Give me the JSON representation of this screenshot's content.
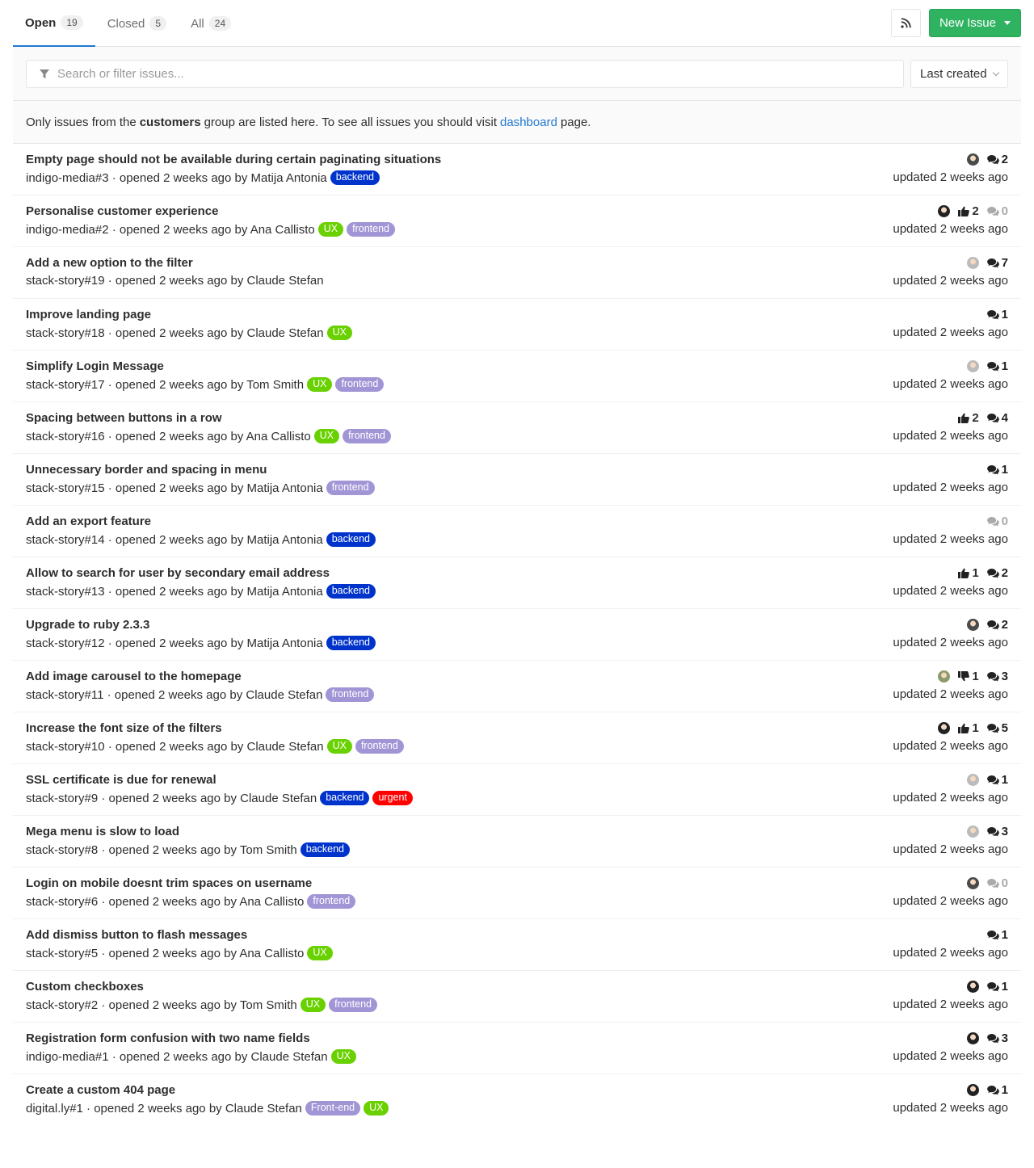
{
  "tabs": [
    {
      "label": "Open",
      "count": "19"
    },
    {
      "label": "Closed",
      "count": "5"
    },
    {
      "label": "All",
      "count": "24"
    }
  ],
  "new_issue_label": "New Issue",
  "search_placeholder": "Search or filter issues...",
  "sort_label": "Last created",
  "info": {
    "prefix": "Only issues from the",
    "group": "customers",
    "middle": "group are listed here. To see all issues you should visit",
    "link": "dashboard",
    "suffix": "page."
  },
  "colors": {
    "ux": "#69d100",
    "frontend": "#a295d6",
    "backend": "#0033cc",
    "urgent": "#ff0000",
    "accent": "#1f78d1",
    "new_issue": "#2fb361"
  },
  "issues": [
    {
      "title": "Empty page should not be available during certain paginating situations",
      "meta": "indigo-media#3 · opened 2 weeks ago by Matija Antonia",
      "labels": [
        {
          "text": "backend",
          "color": "#0033cc"
        }
      ],
      "avatar": "#4a4a4a",
      "up": null,
      "down": null,
      "comments": "2",
      "updated": "updated 2 weeks ago"
    },
    {
      "title": "Personalise customer experience",
      "meta": "indigo-media#2 · opened 2 weeks ago by Ana Callisto",
      "labels": [
        {
          "text": "UX",
          "color": "#69d100"
        },
        {
          "text": "frontend",
          "color": "#a295d6"
        }
      ],
      "avatar": "#222",
      "up": "2",
      "down": null,
      "comments": "0",
      "updated": "updated 2 weeks ago"
    },
    {
      "title": "Add a new option to the filter",
      "meta": "stack-story#19 · opened 2 weeks ago by Claude Stefan",
      "labels": [],
      "avatar": "#bbb",
      "up": null,
      "down": null,
      "comments": "7",
      "updated": "updated 2 weeks ago"
    },
    {
      "title": "Improve landing page",
      "meta": "stack-story#18 · opened 2 weeks ago by Claude Stefan",
      "labels": [
        {
          "text": "UX",
          "color": "#69d100"
        }
      ],
      "avatar": null,
      "up": null,
      "down": null,
      "comments": "1",
      "updated": "updated 2 weeks ago"
    },
    {
      "title": "Simplify Login Message",
      "meta": "stack-story#17 · opened 2 weeks ago by Tom Smith",
      "labels": [
        {
          "text": "UX",
          "color": "#69d100"
        },
        {
          "text": "frontend",
          "color": "#a295d6"
        }
      ],
      "avatar": "#bbb",
      "up": null,
      "down": null,
      "comments": "1",
      "updated": "updated 2 weeks ago"
    },
    {
      "title": "Spacing between buttons in a row",
      "meta": "stack-story#16 · opened 2 weeks ago by Ana Callisto",
      "labels": [
        {
          "text": "UX",
          "color": "#69d100"
        },
        {
          "text": "frontend",
          "color": "#a295d6"
        }
      ],
      "avatar": null,
      "up": "2",
      "down": null,
      "comments": "4",
      "updated": "updated 2 weeks ago"
    },
    {
      "title": "Unnecessary border and spacing in menu",
      "meta": "stack-story#15 · opened 2 weeks ago by Matija Antonia",
      "labels": [
        {
          "text": "frontend",
          "color": "#a295d6"
        }
      ],
      "avatar": null,
      "up": null,
      "down": null,
      "comments": "1",
      "updated": "updated 2 weeks ago"
    },
    {
      "title": "Add an export feature",
      "meta": "stack-story#14 · opened 2 weeks ago by Matija Antonia",
      "labels": [
        {
          "text": "backend",
          "color": "#0033cc"
        }
      ],
      "avatar": null,
      "up": null,
      "down": null,
      "comments": "0",
      "updated": "updated 2 weeks ago"
    },
    {
      "title": "Allow to search for user by secondary email address",
      "meta": "stack-story#13 · opened 2 weeks ago by Matija Antonia",
      "labels": [
        {
          "text": "backend",
          "color": "#0033cc"
        }
      ],
      "avatar": null,
      "up": "1",
      "down": null,
      "comments": "2",
      "updated": "updated 2 weeks ago"
    },
    {
      "title": "Upgrade to ruby 2.3.3",
      "meta": "stack-story#12 · opened 2 weeks ago by Matija Antonia",
      "labels": [
        {
          "text": "backend",
          "color": "#0033cc"
        }
      ],
      "avatar": "#4a4a4a",
      "up": null,
      "down": null,
      "comments": "2",
      "updated": "updated 2 weeks ago"
    },
    {
      "title": "Add image carousel to the homepage",
      "meta": "stack-story#11 · opened 2 weeks ago by Claude Stefan",
      "labels": [
        {
          "text": "frontend",
          "color": "#a295d6"
        }
      ],
      "avatar": "#8a9a6a",
      "up": null,
      "down": "1",
      "comments": "3",
      "updated": "updated 2 weeks ago"
    },
    {
      "title": "Increase the font size of the filters",
      "meta": "stack-story#10 · opened 2 weeks ago by Claude Stefan",
      "labels": [
        {
          "text": "UX",
          "color": "#69d100"
        },
        {
          "text": "frontend",
          "color": "#a295d6"
        }
      ],
      "avatar": "#222",
      "up": "1",
      "down": null,
      "comments": "5",
      "updated": "updated 2 weeks ago"
    },
    {
      "title": "SSL certificate is due for renewal",
      "meta": "stack-story#9 · opened 2 weeks ago by Claude Stefan",
      "labels": [
        {
          "text": "backend",
          "color": "#0033cc"
        },
        {
          "text": "urgent",
          "color": "#ff0000"
        }
      ],
      "avatar": "#bbb",
      "up": null,
      "down": null,
      "comments": "1",
      "updated": "updated 2 weeks ago"
    },
    {
      "title": "Mega menu is slow to load",
      "meta": "stack-story#8 · opened 2 weeks ago by Tom Smith",
      "labels": [
        {
          "text": "backend",
          "color": "#0033cc"
        }
      ],
      "avatar": "#bbb",
      "up": null,
      "down": null,
      "comments": "3",
      "updated": "updated 2 weeks ago"
    },
    {
      "title": "Login on mobile doesnt trim spaces on username",
      "meta": "stack-story#6 · opened 2 weeks ago by Ana Callisto",
      "labels": [
        {
          "text": "frontend",
          "color": "#a295d6"
        }
      ],
      "avatar": "#4a4a4a",
      "up": null,
      "down": null,
      "comments": "0",
      "updated": "updated 2 weeks ago"
    },
    {
      "title": "Add dismiss button to flash messages",
      "meta": "stack-story#5 · opened 2 weeks ago by Ana Callisto",
      "labels": [
        {
          "text": "UX",
          "color": "#69d100"
        }
      ],
      "avatar": null,
      "up": null,
      "down": null,
      "comments": "1",
      "updated": "updated 2 weeks ago"
    },
    {
      "title": "Custom checkboxes",
      "meta": "stack-story#2 · opened 2 weeks ago by Tom Smith",
      "labels": [
        {
          "text": "UX",
          "color": "#69d100"
        },
        {
          "text": "frontend",
          "color": "#a295d6"
        }
      ],
      "avatar": "#222",
      "up": null,
      "down": null,
      "comments": "1",
      "updated": "updated 2 weeks ago"
    },
    {
      "title": "Registration form confusion with two name fields",
      "meta": "indigo-media#1 · opened 2 weeks ago by Claude Stefan",
      "labels": [
        {
          "text": "UX",
          "color": "#69d100"
        }
      ],
      "avatar": "#222",
      "up": null,
      "down": null,
      "comments": "3",
      "updated": "updated 2 weeks ago"
    },
    {
      "title": "Create a custom 404 page",
      "meta": "digital.ly#1 · opened 2 weeks ago by Claude Stefan",
      "labels": [
        {
          "text": "Front-end",
          "color": "#a295d6"
        },
        {
          "text": "UX",
          "color": "#69d100"
        }
      ],
      "avatar": "#222",
      "up": null,
      "down": null,
      "comments": "1",
      "updated": "updated 2 weeks ago"
    }
  ]
}
